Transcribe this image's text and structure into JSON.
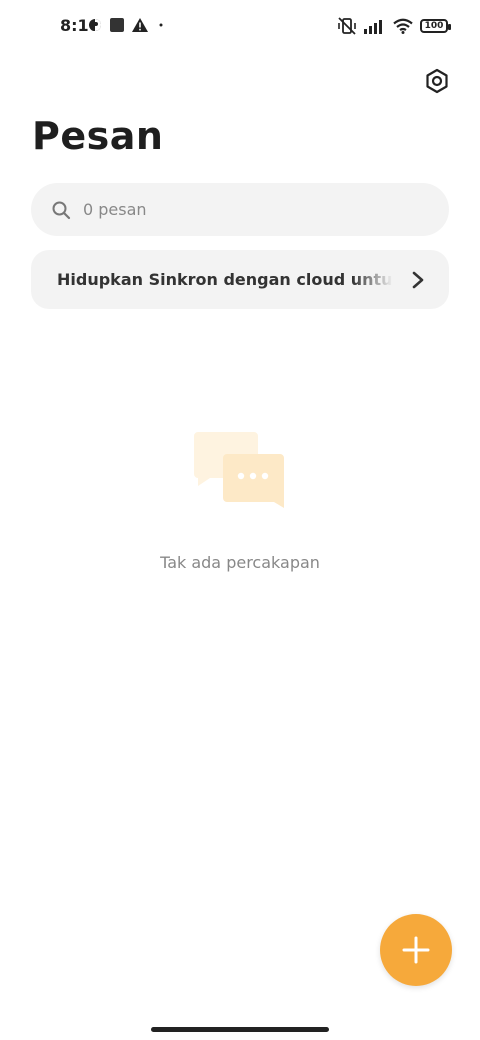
{
  "status_bar": {
    "time": "8:16",
    "battery": "100"
  },
  "header": {
    "title": "Pesan"
  },
  "search": {
    "placeholder": "0 pesan"
  },
  "sync_banner": {
    "text": "Hidupkan Sinkron dengan cloud untuk menyinkronkan"
  },
  "empty_state": {
    "text": "Tak ada percakapan"
  },
  "colors": {
    "accent": "#f6a93b",
    "background": "#ffffff",
    "card": "#f3f3f3",
    "illustration": "#fde9c7"
  },
  "icons": {
    "settings": "settings-hex-icon",
    "search": "search-icon",
    "chevron": "chevron-right-icon",
    "fab": "plus-icon",
    "empty": "chat-bubbles-icon"
  }
}
